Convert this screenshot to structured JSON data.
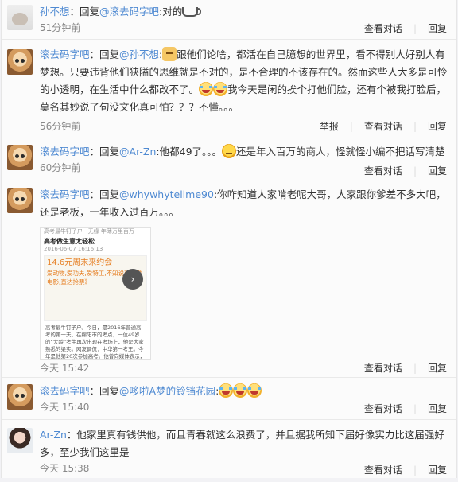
{
  "comments": [
    {
      "user": "孙不想",
      "reply_prefix": "：回复",
      "mention": "@滚去码字吧",
      "text_a": ":对的",
      "time": "51分钟前",
      "actions": [
        "查看对话",
        "回复"
      ]
    },
    {
      "user": "滚去码字吧",
      "reply_prefix": "：回复",
      "mention": "@孙不想",
      "text_a": ":",
      "text_b": "跟他们论啥，都活在自己臆想的世界里，看不得别人好别人有梦想。只要违背他们狭隘的思维就是不对的，是不合理的不该存在的。然而这些人大多是可怜的小透明，在生活中什么都改不了。",
      "text_c": "我今天是闲的挨个打他们脸，还有个被我打脸后，莫名其妙说了句没文化真可怕？？？不懂。。。",
      "time": "56分钟前",
      "actions": [
        "举报",
        "查看对话",
        "回复"
      ]
    },
    {
      "user": "滚去码字吧",
      "reply_prefix": "：回复",
      "mention": "@Ar-Zn",
      "text_a": ":他都49了。。。",
      "text_b": "还是年入百万的商人，怪就怪小编不把话写清楚",
      "time": "60分钟前",
      "actions": [
        "查看对话",
        "回复"
      ]
    },
    {
      "user": "滚去码字吧",
      "reply_prefix": "：回复",
      "mention": "@whywhytellme90",
      "text_a": ":你咋知道人家啃老呢大哥，人家跟你爹差不多大吧，还是老板，一年收入过百万。。。",
      "time": "今天 15:42",
      "actions": [
        "查看对话",
        "回复"
      ],
      "image": {
        "top_line": "高考最牛钉子户 · 无缘  年薄万里百万",
        "headline": "高考做生意太轻松",
        "date": "2016-06-07 16:16:13",
        "ad_big": "14.6元周末来约会",
        "ad_text": "爱动物,爱功夫,爱特工,不知说就是爱电影,直达抢票》",
        "article": "高考最牛钉子户。今日，是2016年普通高考的第一天，在绵阳市的考点，一位49岁的“大龄”考生再次出现在考场上，他是大家熟悉的梁实。网友调侃：中华第一考王。今年是他第20次参加高考。他曾向媒体表示，2016年将是他的终极一战。“再不成功，就放弃一切都结束了”，同意于是考过的"
      }
    },
    {
      "user": "滚去码字吧",
      "reply_prefix": "：回复",
      "mention": "@哆啦A梦的铃铛花园",
      "text_a": ":",
      "time": "今天 15:40",
      "actions": [
        "查看对话",
        "回复"
      ]
    },
    {
      "user": "Ar-Zn",
      "reply_prefix": "：",
      "text_a": "他家里真有钱供他，而且青春就这么浪费了，并且据我所知下届好像实力比这届强好多，至少我们这里是",
      "time": "今天 15:38",
      "actions": [
        "查看对话",
        "回复"
      ]
    }
  ],
  "colors": {
    "link": "#4f8ad2",
    "text": "#333333",
    "time": "#888888"
  }
}
